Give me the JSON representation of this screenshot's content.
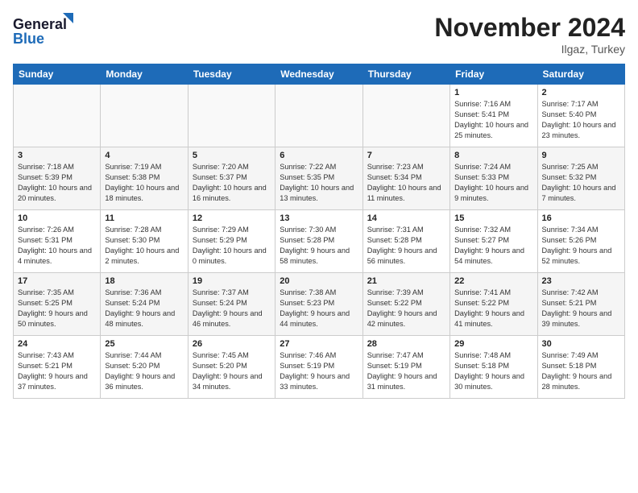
{
  "header": {
    "logo_general": "General",
    "logo_blue": "Blue",
    "month_title": "November 2024",
    "location": "Ilgaz, Turkey"
  },
  "days_of_week": [
    "Sunday",
    "Monday",
    "Tuesday",
    "Wednesday",
    "Thursday",
    "Friday",
    "Saturday"
  ],
  "weeks": [
    [
      {
        "day": "",
        "info": ""
      },
      {
        "day": "",
        "info": ""
      },
      {
        "day": "",
        "info": ""
      },
      {
        "day": "",
        "info": ""
      },
      {
        "day": "",
        "info": ""
      },
      {
        "day": "1",
        "info": "Sunrise: 7:16 AM\nSunset: 5:41 PM\nDaylight: 10 hours and 25 minutes."
      },
      {
        "day": "2",
        "info": "Sunrise: 7:17 AM\nSunset: 5:40 PM\nDaylight: 10 hours and 23 minutes."
      }
    ],
    [
      {
        "day": "3",
        "info": "Sunrise: 7:18 AM\nSunset: 5:39 PM\nDaylight: 10 hours and 20 minutes."
      },
      {
        "day": "4",
        "info": "Sunrise: 7:19 AM\nSunset: 5:38 PM\nDaylight: 10 hours and 18 minutes."
      },
      {
        "day": "5",
        "info": "Sunrise: 7:20 AM\nSunset: 5:37 PM\nDaylight: 10 hours and 16 minutes."
      },
      {
        "day": "6",
        "info": "Sunrise: 7:22 AM\nSunset: 5:35 PM\nDaylight: 10 hours and 13 minutes."
      },
      {
        "day": "7",
        "info": "Sunrise: 7:23 AM\nSunset: 5:34 PM\nDaylight: 10 hours and 11 minutes."
      },
      {
        "day": "8",
        "info": "Sunrise: 7:24 AM\nSunset: 5:33 PM\nDaylight: 10 hours and 9 minutes."
      },
      {
        "day": "9",
        "info": "Sunrise: 7:25 AM\nSunset: 5:32 PM\nDaylight: 10 hours and 7 minutes."
      }
    ],
    [
      {
        "day": "10",
        "info": "Sunrise: 7:26 AM\nSunset: 5:31 PM\nDaylight: 10 hours and 4 minutes."
      },
      {
        "day": "11",
        "info": "Sunrise: 7:28 AM\nSunset: 5:30 PM\nDaylight: 10 hours and 2 minutes."
      },
      {
        "day": "12",
        "info": "Sunrise: 7:29 AM\nSunset: 5:29 PM\nDaylight: 10 hours and 0 minutes."
      },
      {
        "day": "13",
        "info": "Sunrise: 7:30 AM\nSunset: 5:28 PM\nDaylight: 9 hours and 58 minutes."
      },
      {
        "day": "14",
        "info": "Sunrise: 7:31 AM\nSunset: 5:28 PM\nDaylight: 9 hours and 56 minutes."
      },
      {
        "day": "15",
        "info": "Sunrise: 7:32 AM\nSunset: 5:27 PM\nDaylight: 9 hours and 54 minutes."
      },
      {
        "day": "16",
        "info": "Sunrise: 7:34 AM\nSunset: 5:26 PM\nDaylight: 9 hours and 52 minutes."
      }
    ],
    [
      {
        "day": "17",
        "info": "Sunrise: 7:35 AM\nSunset: 5:25 PM\nDaylight: 9 hours and 50 minutes."
      },
      {
        "day": "18",
        "info": "Sunrise: 7:36 AM\nSunset: 5:24 PM\nDaylight: 9 hours and 48 minutes."
      },
      {
        "day": "19",
        "info": "Sunrise: 7:37 AM\nSunset: 5:24 PM\nDaylight: 9 hours and 46 minutes."
      },
      {
        "day": "20",
        "info": "Sunrise: 7:38 AM\nSunset: 5:23 PM\nDaylight: 9 hours and 44 minutes."
      },
      {
        "day": "21",
        "info": "Sunrise: 7:39 AM\nSunset: 5:22 PM\nDaylight: 9 hours and 42 minutes."
      },
      {
        "day": "22",
        "info": "Sunrise: 7:41 AM\nSunset: 5:22 PM\nDaylight: 9 hours and 41 minutes."
      },
      {
        "day": "23",
        "info": "Sunrise: 7:42 AM\nSunset: 5:21 PM\nDaylight: 9 hours and 39 minutes."
      }
    ],
    [
      {
        "day": "24",
        "info": "Sunrise: 7:43 AM\nSunset: 5:21 PM\nDaylight: 9 hours and 37 minutes."
      },
      {
        "day": "25",
        "info": "Sunrise: 7:44 AM\nSunset: 5:20 PM\nDaylight: 9 hours and 36 minutes."
      },
      {
        "day": "26",
        "info": "Sunrise: 7:45 AM\nSunset: 5:20 PM\nDaylight: 9 hours and 34 minutes."
      },
      {
        "day": "27",
        "info": "Sunrise: 7:46 AM\nSunset: 5:19 PM\nDaylight: 9 hours and 33 minutes."
      },
      {
        "day": "28",
        "info": "Sunrise: 7:47 AM\nSunset: 5:19 PM\nDaylight: 9 hours and 31 minutes."
      },
      {
        "day": "29",
        "info": "Sunrise: 7:48 AM\nSunset: 5:18 PM\nDaylight: 9 hours and 30 minutes."
      },
      {
        "day": "30",
        "info": "Sunrise: 7:49 AM\nSunset: 5:18 PM\nDaylight: 9 hours and 28 minutes."
      }
    ]
  ]
}
